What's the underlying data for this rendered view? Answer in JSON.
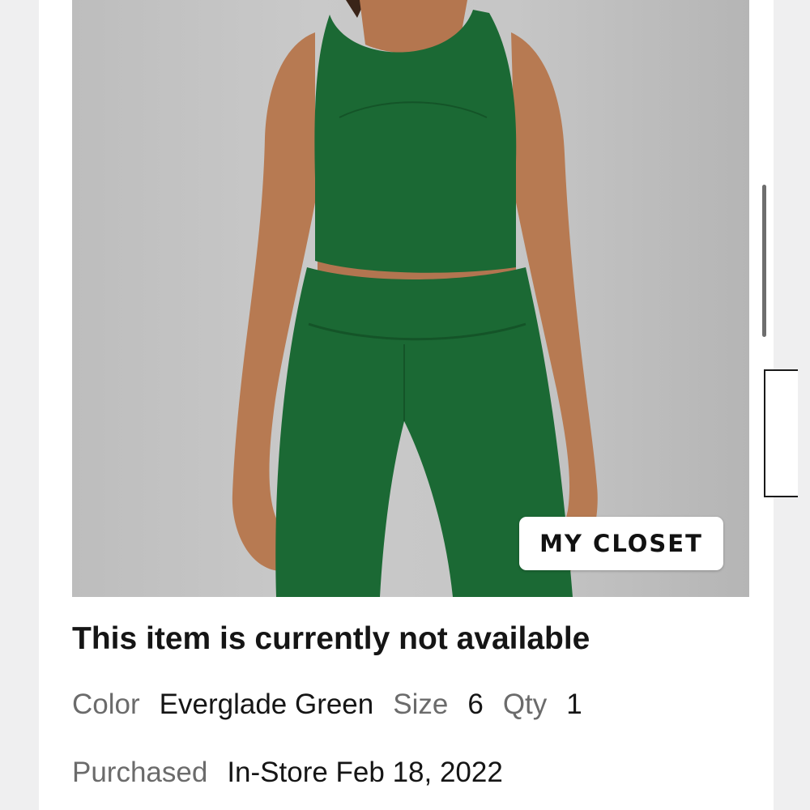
{
  "product": {
    "image_alt": "Woman wearing green cropped tank top and matching leggings",
    "badge_label": "MY CLOSET",
    "status": "This item is currently not available"
  },
  "details": {
    "color_label": "Color",
    "color_value": "Everglade Green",
    "size_label": "Size",
    "size_value": "6",
    "qty_label": "Qty",
    "qty_value": "1"
  },
  "purchase": {
    "label": "Purchased",
    "value": "In-Store Feb 18, 2022"
  },
  "colors": {
    "garment": "#1b6934",
    "skin": "#b77a52",
    "backdrop": "#c6c6c6"
  }
}
